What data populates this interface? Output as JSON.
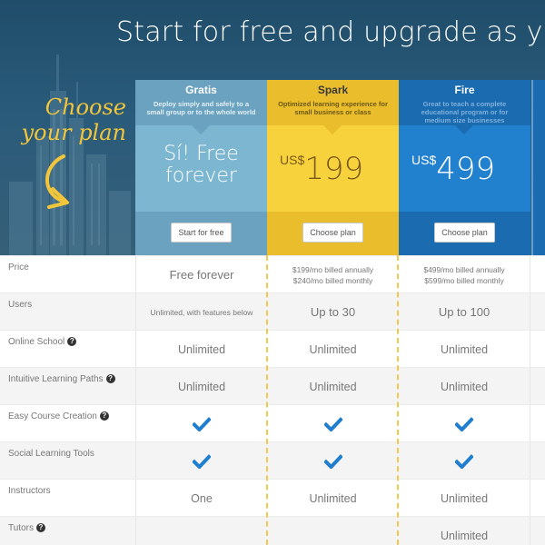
{
  "hero": {
    "headline": "Start for free and upgrade as you go",
    "choose_label": "Choose your plan",
    "accent_color": "#f2c63a"
  },
  "plans": [
    {
      "name": "Gratis",
      "description": "Deploy simply and safely to a small group or to the whole world",
      "price_text": "Sí! Free forever",
      "button_label": "Start for free",
      "color": "#7db6d1"
    },
    {
      "name": "Spark",
      "description": "Optimized learning experience for small business or class",
      "currency": "US$",
      "price": "199",
      "button_label": "Choose plan",
      "color": "#f8d23d"
    },
    {
      "name": "Fire",
      "description": "Great to teach a complete educational program or for medium size businesses",
      "currency": "US$",
      "price": "499",
      "button_label": "Choose plan",
      "color": "#2181cf"
    }
  ],
  "features": [
    {
      "label": "Price",
      "help": false,
      "values": [
        "Free forever",
        "$199/mo billed annually\n$240/mo billed monthly",
        "$499/mo billed annually\n$599/mo billed monthly"
      ]
    },
    {
      "label": "Users",
      "help": false,
      "values": [
        "Unlimited, with features below",
        "Up to 30",
        "Up to 100"
      ]
    },
    {
      "label": "Online School",
      "help": true,
      "values": [
        "Unlimited",
        "Unlimited",
        "Unlimited"
      ]
    },
    {
      "label": "Intuitive Learning Paths",
      "help": true,
      "values": [
        "Unlimited",
        "Unlimited",
        "Unlimited"
      ]
    },
    {
      "label": "Easy Course Creation",
      "help": true,
      "values": [
        "check",
        "check",
        "check"
      ]
    },
    {
      "label": "Social Learning Tools",
      "help": false,
      "values": [
        "check",
        "check",
        "check"
      ]
    },
    {
      "label": "Instructors",
      "help": false,
      "values": [
        "One",
        "Unlimited",
        "Unlimited"
      ]
    },
    {
      "label": "Tutors",
      "help": true,
      "values": [
        "",
        "",
        "Unlimited"
      ]
    }
  ],
  "check_color": "#1f7ed0"
}
